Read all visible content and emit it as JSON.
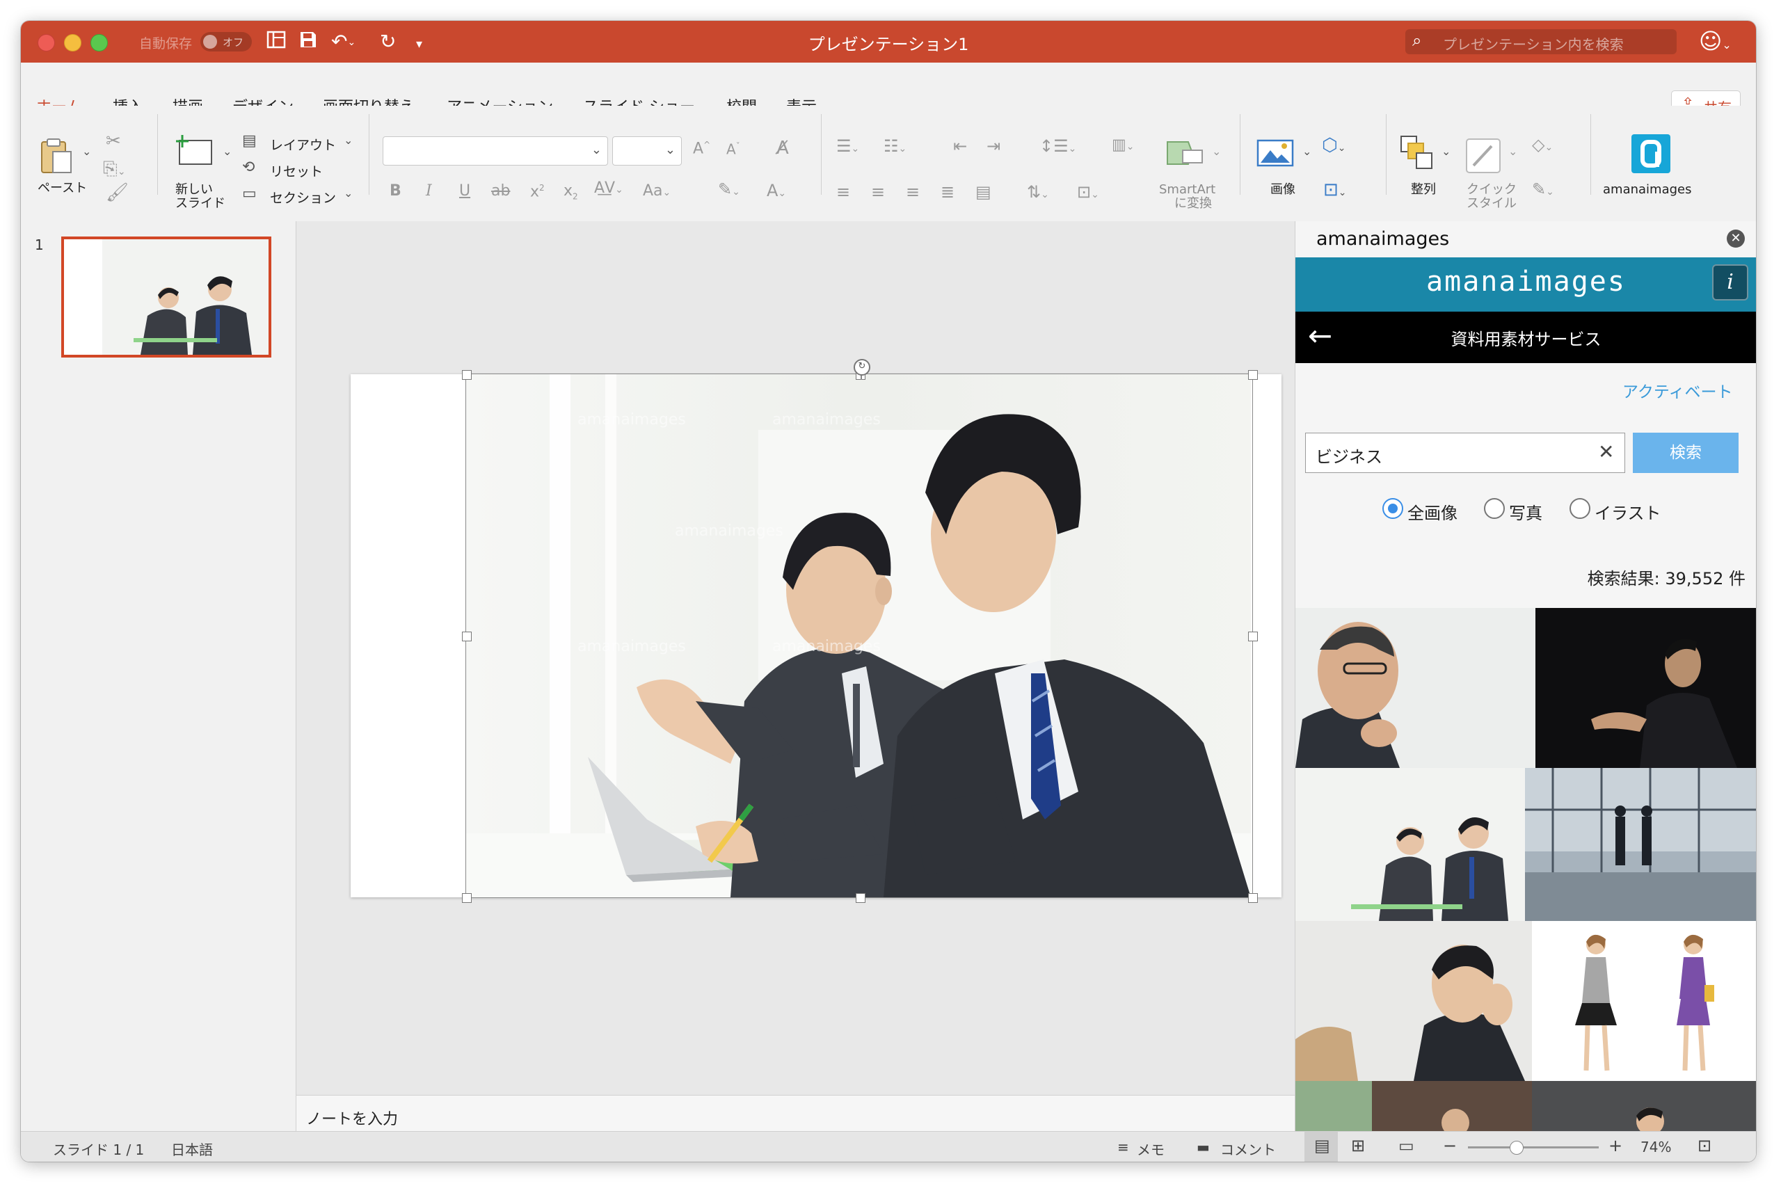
{
  "window": {
    "title": "プレゼンテーション1",
    "autosave_label": "自動保存",
    "autosave_state": "オフ",
    "search_placeholder": "プレゼンテーション内を検索"
  },
  "tabs": [
    {
      "label": "ホーム",
      "active": true
    },
    {
      "label": "挿入"
    },
    {
      "label": "描画"
    },
    {
      "label": "デザイン"
    },
    {
      "label": "画面切り替え"
    },
    {
      "label": "アニメーション"
    },
    {
      "label": "スライド ショー"
    },
    {
      "label": "校閲"
    },
    {
      "label": "表示"
    }
  ],
  "share_label": "共有",
  "ribbon": {
    "paste": "ペースト",
    "new_slide_line1": "新しい",
    "new_slide_line2": "スライド",
    "layout": "レイアウト",
    "reset": "リセット",
    "section": "セクション",
    "font_name": "",
    "font_size": "",
    "smartart_line1": "SmartArt",
    "smartart_line2": "に変換",
    "picture": "画像",
    "arrange": "整列",
    "quick_styles_line1": "クイック",
    "quick_styles_line2": "スタイル",
    "addin_name": "amanaimages"
  },
  "thumbnails": [
    {
      "number": "1"
    }
  ],
  "notes_placeholder": "ノートを入力",
  "addin": {
    "title": "amanaimages",
    "brand": "amanaimages",
    "info": "i",
    "service_title": "資料用素材サービス",
    "activate": "アクティベート",
    "search_value": "ビジネス",
    "search_button": "検索",
    "filters": [
      {
        "label": "全画像",
        "selected": true
      },
      {
        "label": "写真",
        "selected": false
      },
      {
        "label": "イラスト",
        "selected": false
      }
    ],
    "results": "検索結果: 39,552 件"
  },
  "status": {
    "slide": "スライド 1 / 1",
    "language": "日本語",
    "notes": "メモ",
    "comments": "コメント",
    "zoom": "74%",
    "zoom_minus": "−",
    "zoom_plus": "+"
  },
  "colors": {
    "accent": "#c9482e",
    "brand": "#1a87a8",
    "link": "#3a9ad9",
    "search_button": "#6ab4ec"
  }
}
